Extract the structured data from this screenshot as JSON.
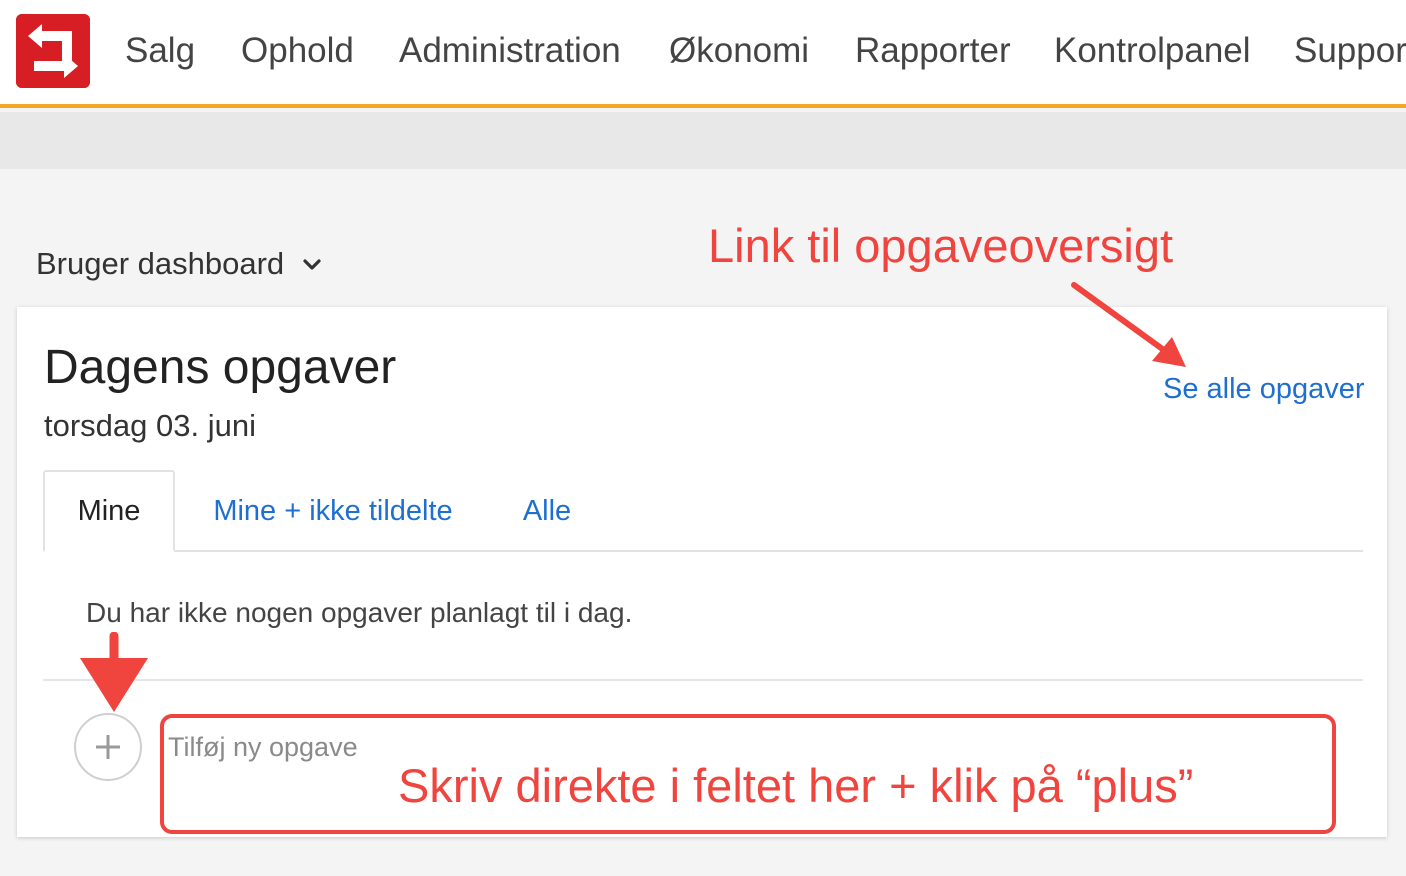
{
  "nav": {
    "logo": "sirvoy-logo",
    "items": [
      "Salg",
      "Ophold",
      "Administration",
      "Økonomi",
      "Rapporter",
      "Kontrolpanel",
      "Support"
    ]
  },
  "dashboard": {
    "selector_label": "Bruger dashboard"
  },
  "tasks": {
    "title": "Dagens opgaver",
    "date": "torsdag 03. juni",
    "see_all_link": "Se alle opgaver",
    "tabs": [
      {
        "label": "Mine",
        "active": true
      },
      {
        "label": "Mine + ikke tildelte",
        "active": false
      },
      {
        "label": "Alle",
        "active": false
      }
    ],
    "empty_message": "Du har ikke nogen opgaver planlagt til i dag.",
    "new_task_placeholder": "Tilføj ny opgave"
  },
  "annotations": {
    "top_note": "Link til opgaveoversigt",
    "bottom_note": "Skriv direkte i feltet her + klik på “plus”",
    "color": "#f0443e"
  },
  "colors": {
    "brand": "#d81e25",
    "accent_border": "#f5a623",
    "link": "#1e6fd0"
  }
}
